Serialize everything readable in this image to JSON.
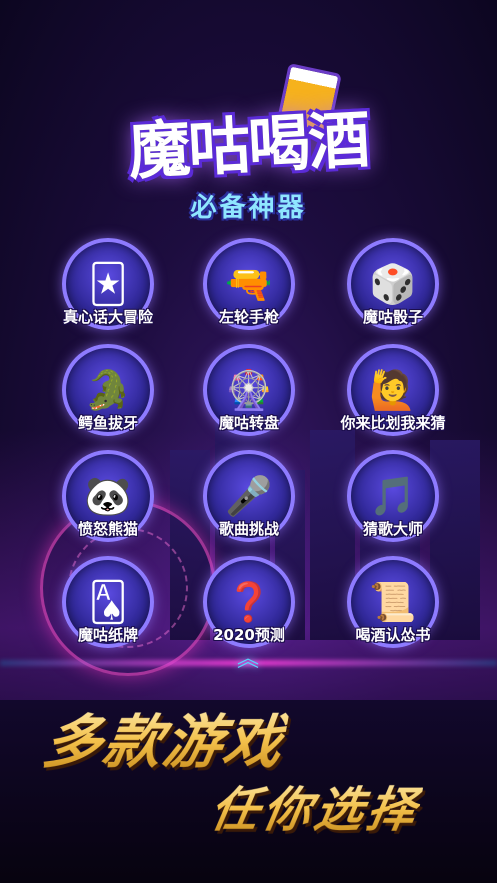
{
  "logo": {
    "title": "魔咕喝酒",
    "subtitle": "必备神器"
  },
  "games": [
    {
      "label": "真心话大冒险",
      "icon": "tarot-cards-icon",
      "glyph": "🃏"
    },
    {
      "label": "左轮手枪",
      "icon": "revolver-icon",
      "glyph": "🔫"
    },
    {
      "label": "魔咕骰子",
      "icon": "dice-icon",
      "glyph": "🎲"
    },
    {
      "label": "鳄鱼拔牙",
      "icon": "crocodile-icon",
      "glyph": "🐊"
    },
    {
      "label": "魔咕转盘",
      "icon": "spin-wheel-icon",
      "glyph": "🎡"
    },
    {
      "label": "你来比划我来猜",
      "icon": "charades-avatar-icon",
      "glyph": "🙋"
    },
    {
      "label": "愤怒熊猫",
      "icon": "angry-panda-icon",
      "glyph": "🐼"
    },
    {
      "label": "歌曲挑战",
      "icon": "microphone-icon",
      "glyph": "🎤"
    },
    {
      "label": "猜歌大师",
      "icon": "music-note-icon",
      "glyph": "🎵"
    },
    {
      "label": "魔咕纸牌",
      "icon": "playing-cards-icon",
      "glyph": "🂡"
    },
    {
      "label": "2020预测",
      "icon": "question-mark-icon",
      "glyph": "❓"
    },
    {
      "label": "喝酒认怂书",
      "icon": "certificate-icon",
      "glyph": "📜"
    }
  ],
  "tagline": {
    "line1": "多款游戏",
    "line2": "任你选择"
  },
  "colors": {
    "accent": "#8e7bff",
    "background": "#1d0d3f",
    "tagline": "#f3c04a"
  }
}
